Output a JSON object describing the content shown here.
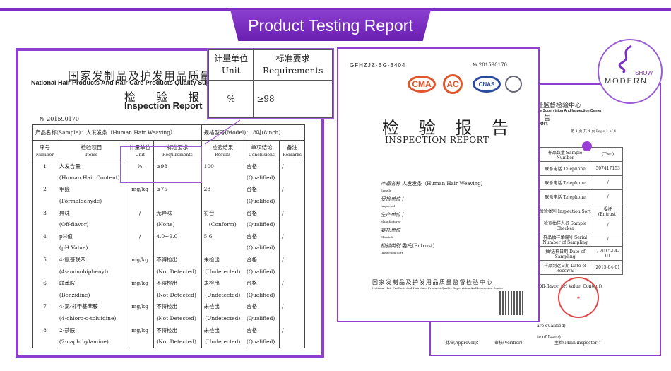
{
  "banner": {
    "title": "Product Testing Report"
  },
  "left_doc": {
    "title_cn": "国家发制品及护发用品质量监督",
    "title_en": "National Hair Products And Hair Care Products Quality Super",
    "report_cn": "检 验 报 告",
    "report_en": "Inspection Report",
    "number": "№ 201590170",
    "sample": "产品名称(Sample)：人发发条（Human Hair Weaving）",
    "model": "规格型号(Model)： 8吋(8inch)",
    "headers": [
      {
        "cn": "序号",
        "en": "Number"
      },
      {
        "cn": "检验项目",
        "en": "Items"
      },
      {
        "cn": "计量单位",
        "en": "Unit"
      },
      {
        "cn": "标准要求",
        "en": "Requirements"
      },
      {
        "cn": "检验结果",
        "en": "Results"
      },
      {
        "cn": "单项结论",
        "en": "Conclusions"
      },
      {
        "cn": "备注",
        "en": "Remarks"
      }
    ],
    "rows": [
      {
        "n": "1",
        "cn": "人发含量",
        "en": "(Human Hair Content)",
        "unit": "%",
        "req": "≥98",
        "req2": "",
        "res": "100",
        "res2": "",
        "con": "合格",
        "con2": "(Qualified)",
        "rem": "/"
      },
      {
        "n": "2",
        "cn": "甲醛",
        "en": "(Formaldehyde)",
        "unit": "mg/kg",
        "req": "≤75",
        "req2": "",
        "res": "28",
        "res2": "",
        "con": "合格",
        "con2": "(Qualified)",
        "rem": "/"
      },
      {
        "n": "3",
        "cn": "异味",
        "en": "(Off-flavor)",
        "unit": "/",
        "req": "无异味",
        "req2": "(None)",
        "res": "符合",
        "res2": "(Conform)",
        "con": "合格",
        "con2": "(Qualified)",
        "rem": "/"
      },
      {
        "n": "4",
        "cn": "pH值",
        "en": "(pH Value)",
        "unit": "/",
        "req": "4.0~9.0",
        "req2": "",
        "res": "5.6",
        "res2": "",
        "con": "合格",
        "con2": "(Qualified)",
        "rem": "/"
      },
      {
        "n": "5",
        "cn": "4-氨基联苯",
        "en": "(4-aminobiphenyl)",
        "unit": "mg/kg",
        "req": "不得检出",
        "req2": "(Not Detected)",
        "res": "未检出",
        "res2": "(Undetected)",
        "con": "合格",
        "con2": "(Qualified)",
        "rem": "/"
      },
      {
        "n": "6",
        "cn": "联苯胺",
        "en": "(Benzidine)",
        "unit": "mg/kg",
        "req": "不得检出",
        "req2": "(Not Detected)",
        "res": "未检出",
        "res2": "(Undetected)",
        "con": "合格",
        "con2": "(Qualified)",
        "rem": "/"
      },
      {
        "n": "7",
        "cn": "4-氯-邻甲基苯胺",
        "en": "(4-chloro-o-toluidine)",
        "unit": "mg/kg",
        "req": "不得检出",
        "req2": "(Not Detected)",
        "res": "未检出",
        "res2": "(Undetected)",
        "con": "合格",
        "con2": "(Qualified)",
        "rem": "/"
      },
      {
        "n": "8",
        "cn": "2-萘胺",
        "en": "(2-naphthylamine)",
        "unit": "mg/kg",
        "req": "不得检出",
        "req2": "(Not Detected)",
        "res": "未检出",
        "res2": "(Undetected)",
        "con": "合格",
        "con2": "(Qualified)",
        "rem": "/"
      }
    ]
  },
  "callout": {
    "unit_cn": "计量单位",
    "unit_en": "Unit",
    "req_cn": "标准要求",
    "req_en": "Requirements",
    "unit_val": "%",
    "req_val": "≥98"
  },
  "mid_doc": {
    "code": "GFHZJZ-BG-3404",
    "number": "№ 201590170",
    "certs": [
      "CMA",
      "AC",
      "CNAS"
    ],
    "title_cn": "检 验 报 告",
    "title_en": "INSPECTION REPORT",
    "fields": [
      {
        "cn": "产品名称",
        "en": "Sample",
        "val": "人发发条（Human Hair Weaving）"
      },
      {
        "cn": "受检单位",
        "en": "Inspected",
        "val": "/"
      },
      {
        "cn": "生产单位",
        "en": "Manufacturer",
        "val": "/"
      },
      {
        "cn": "委托单位",
        "en": "Clientele",
        "val": ""
      },
      {
        "cn": "检验类别",
        "en": "Inspection Sort",
        "val": "委托(Entrust)"
      }
    ],
    "footer_cn": "国家发制品及护发用品质量监督检验中心",
    "footer_en": "National Hair Products And Hair Care Products Quality Supervision And Inspection Center"
  },
  "right_doc": {
    "title_cn": "量监督检验中心",
    "title_en": "lity Supervision And Inspection Center",
    "report_cn": "告",
    "report_en": "port",
    "page": "第 1 页 共 4 页  Page 1 of 4",
    "rows": [
      {
        "label": "样品数量 Sample Number",
        "val": "(Two)"
      },
      {
        "label": "联系电话 Telephone",
        "val": "507417153"
      },
      {
        "label": "联系电话 Telephone",
        "val": "/"
      },
      {
        "label": "联系电话 Telephone",
        "val": "/"
      },
      {
        "label": "检验类别 Inspection Sort",
        "val": "委托(Entrust)"
      },
      {
        "label": "检查抽样人员 Sample Checker",
        "val": "/"
      },
      {
        "label": "样品抽样单编号 Serial Number of Sampling",
        "val": "/"
      },
      {
        "label": "抽/送样日期 Date of Sampling",
        "val": "/ 2015-04-01"
      },
      {
        "label": "样品到达日期 Date of Receival",
        "val": "2015-04-01"
      }
    ],
    "note1": "(Off-flavor, pH Value, Content)",
    "note2": "are qualified)",
    "note3": "te of Issue)：",
    "approver": "批准(Approver)：",
    "verifier": "审核(Verifier)：",
    "inspector": "主检(Main inspector)："
  },
  "logo": {
    "line1": "SHOW",
    "line2": "MODERN"
  },
  "colors": {
    "accent": "#8e3fcf",
    "stamp": "#d44444",
    "cert": "#e0552a"
  }
}
